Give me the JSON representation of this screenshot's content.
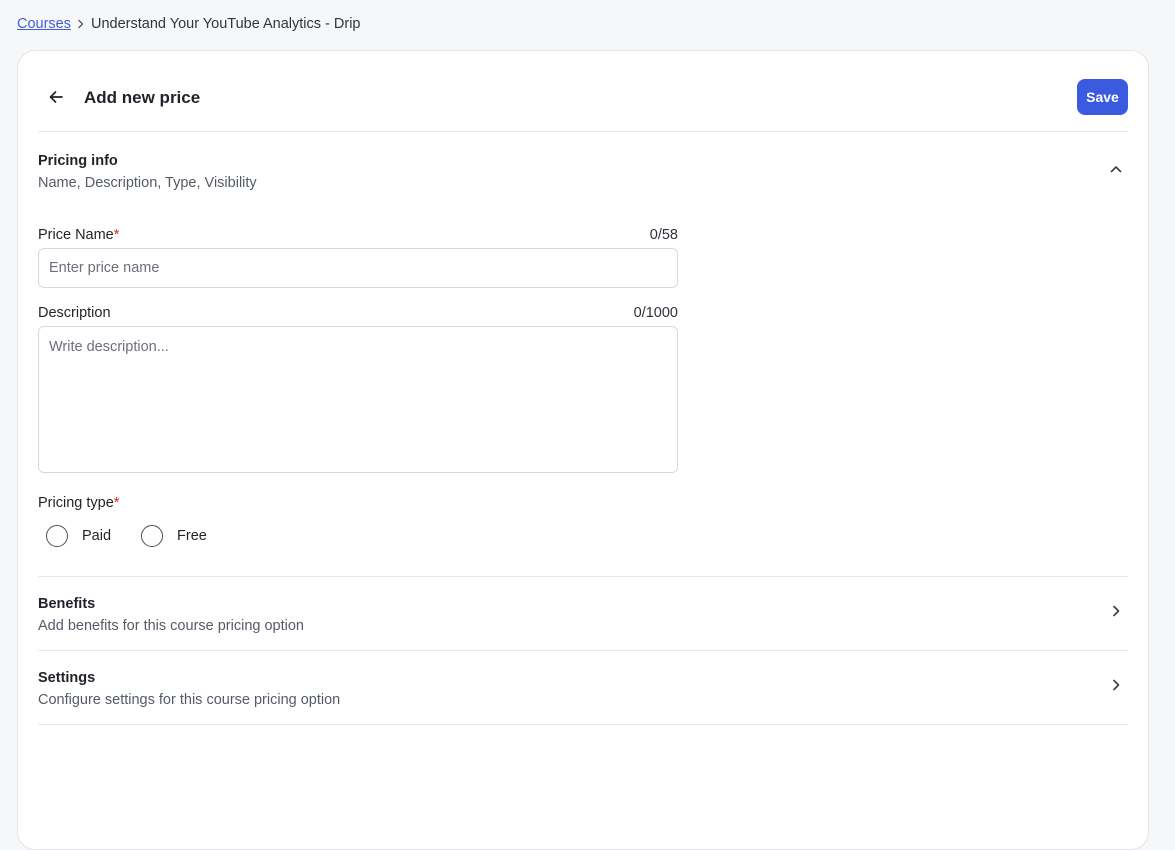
{
  "breadcrumb": {
    "root": "Courses",
    "current": "Understand Your YouTube Analytics - Drip"
  },
  "header": {
    "title": "Add new price",
    "save_label": "Save"
  },
  "pricing_info": {
    "title": "Pricing info",
    "subtitle": "Name, Description, Type, Visibility"
  },
  "price_name": {
    "label": "Price Name",
    "required_mark": "*",
    "counter": "0/58",
    "placeholder": "Enter price name",
    "value": ""
  },
  "description": {
    "label": "Description",
    "counter": "0/1000",
    "placeholder": "Write description...",
    "value": ""
  },
  "pricing_type": {
    "label": "Pricing type",
    "required_mark": "*",
    "options": [
      "Paid",
      "Free"
    ]
  },
  "benefits": {
    "title": "Benefits",
    "subtitle": "Add benefits for this course pricing option"
  },
  "settings": {
    "title": "Settings",
    "subtitle": "Configure settings for this course pricing option"
  },
  "colors": {
    "accent": "#3a5be0",
    "required": "#e0242b",
    "link": "#3f5fd8"
  }
}
